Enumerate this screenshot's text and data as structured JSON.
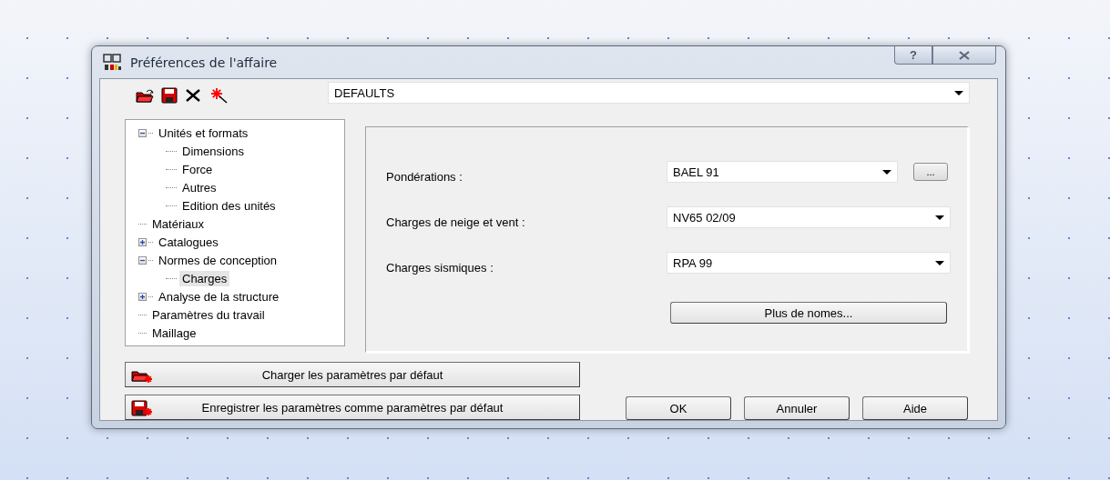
{
  "window": {
    "title": "Préférences de l'affaire",
    "help_button": "?"
  },
  "preset": {
    "value": "DEFAULTS"
  },
  "tree": [
    {
      "label": "Unités et formats",
      "expanded": true,
      "selected": false,
      "children": [
        {
          "label": "Dimensions",
          "selected": false
        },
        {
          "label": "Force",
          "selected": false
        },
        {
          "label": "Autres",
          "selected": false
        },
        {
          "label": "Edition des unités",
          "selected": false
        }
      ]
    },
    {
      "label": "Matériaux",
      "selected": false
    },
    {
      "label": "Catalogues",
      "expanded": false,
      "selected": false
    },
    {
      "label": "Normes de conception",
      "expanded": true,
      "selected": false,
      "children": [
        {
          "label": "Charges",
          "selected": true
        }
      ]
    },
    {
      "label": "Analyse de la structure",
      "expanded": false,
      "selected": false
    },
    {
      "label": "Paramètres du travail",
      "selected": false
    },
    {
      "label": "Maillage",
      "selected": false
    }
  ],
  "settings": [
    {
      "label": "Pondérations :",
      "value": "BAEL 91",
      "browse_button": "..."
    },
    {
      "label": "Charges de neige et vent :",
      "value": "NV65 02/09"
    },
    {
      "label": "Charges sismiques :",
      "value": "RPA 99"
    }
  ],
  "more_button": "Plus de nomes...",
  "default_buttons": [
    {
      "kind": "load",
      "label": "Charger les paramètres par défaut"
    },
    {
      "kind": "save",
      "label": "Enregistrer les paramètres comme paramètres par défaut"
    }
  ],
  "dialog_buttons": [
    "OK",
    "Annuler",
    "Aide"
  ]
}
